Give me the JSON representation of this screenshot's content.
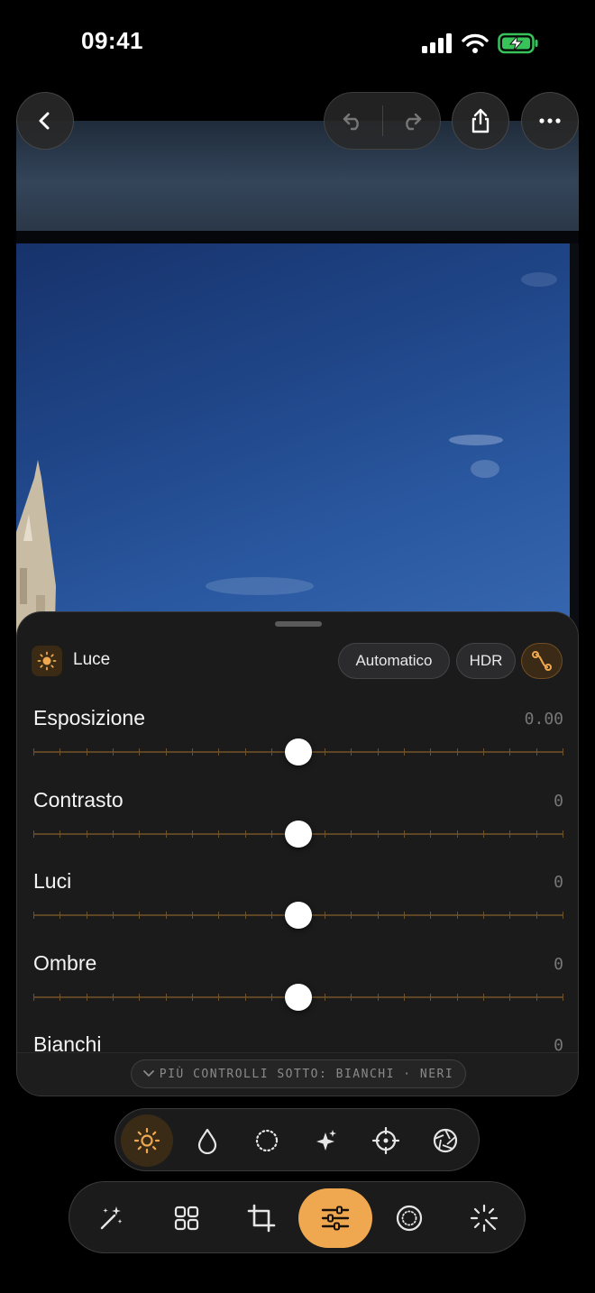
{
  "status": {
    "time": "09:41"
  },
  "panel": {
    "title": "Luce",
    "chips": {
      "auto": "Automatico",
      "hdr": "HDR"
    },
    "sliders": [
      {
        "label": "Esposizione",
        "value": "0.00",
        "position": 0.5
      },
      {
        "label": "Contrasto",
        "value": "0",
        "position": 0.5
      },
      {
        "label": "Luci",
        "value": "0",
        "position": 0.5
      },
      {
        "label": "Ombre",
        "value": "0",
        "position": 0.5
      },
      {
        "label": "Bianchi",
        "value": "0",
        "position": 0.5
      }
    ],
    "more": "PIÙ CONTROLLI SOTTO: BIANCHI · NERI"
  },
  "colors": {
    "accent": "#f0a850",
    "background": "#000000",
    "panel": "#1b1b1b",
    "sky": "#2a58a0"
  },
  "icons": {
    "top": [
      "chevron-left-icon",
      "undo-icon",
      "redo-icon",
      "share-icon",
      "more-icon"
    ],
    "categories": [
      "sun-icon",
      "drop-icon",
      "dotted-circle-icon",
      "sparkle-icon",
      "target-icon",
      "aperture-icon"
    ],
    "tools": [
      "magic-wand-icon",
      "grid-icon",
      "crop-icon",
      "sliders-icon",
      "circle-filter-icon",
      "burst-icon"
    ]
  },
  "selected": {
    "category": "sun-icon",
    "tool": "sliders-icon"
  }
}
